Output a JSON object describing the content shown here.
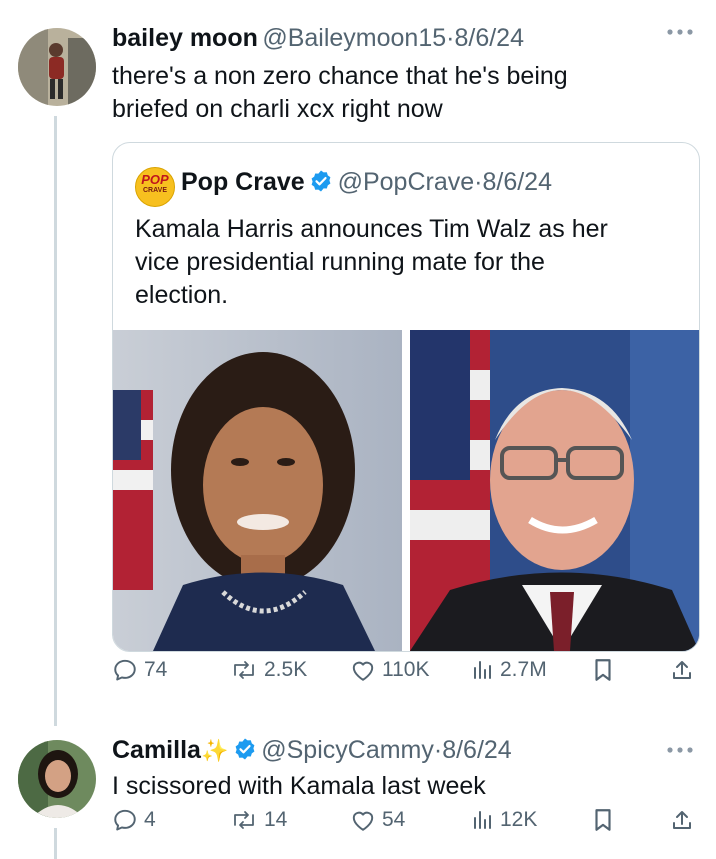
{
  "tweet": {
    "author_name": "bailey moon",
    "handle": "@Baileymoon15",
    "separator": "·",
    "date": "8/6/24",
    "text_line1": "there's a non zero chance that he's being",
    "text_line2": "briefed on charli xcx right now",
    "more_icon": "more-icon",
    "quote": {
      "logo_text_top": "POP",
      "logo_text_bottom": "CRAVE",
      "author_name": "Pop Crave",
      "handle": "@PopCrave",
      "separator": "·",
      "date": "8/6/24",
      "text_line1": "Kamala Harris announces Tim Walz as her",
      "text_line2": "vice presidential running mate for the",
      "text_line3": "election."
    },
    "stats": {
      "replies": "74",
      "reposts": "2.5K",
      "likes": "110K",
      "views": "2.7M"
    }
  },
  "reply": {
    "author_name": "Camilla",
    "sparkle": "✨",
    "handle": "@SpicyCammy",
    "separator": "·",
    "date": "8/6/24",
    "text": "I scissored with Kamala last week",
    "stats": {
      "replies": "4",
      "reposts": "14",
      "likes": "54",
      "views": "12K"
    }
  },
  "colors": {
    "verified": "#1d9bf0",
    "muted": "#536471",
    "border": "#cfd9de",
    "logo_bg": "#f7c01f"
  }
}
